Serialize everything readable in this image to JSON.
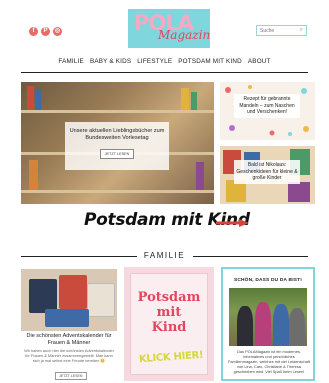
{
  "header": {
    "social": [
      "f",
      "P",
      "◎"
    ],
    "logo_main": "POLA",
    "logo_sub": "Magazin",
    "search_placeholder": "Suche"
  },
  "nav": {
    "items": [
      "FAMILIE",
      "BABY & KIDS",
      "LIFESTYLE",
      "POTSDAM MIT KIND",
      "ABOUT"
    ]
  },
  "hero": {
    "title": "Unsere aktuellen Lieblingsbücher zum Bundesweiten Vorlesetag",
    "button": "JETZT LESEN"
  },
  "side_posts": [
    {
      "title": "Rezept für gebrannte Mandeln – zum Naschen und Verschenken!"
    },
    {
      "title": "Bald ist Nikolaus: Geschenkideen für kleine & große Kinder"
    }
  ],
  "banner": {
    "text": "Potsdam mit Kind"
  },
  "section": {
    "title": "FAMILIE"
  },
  "card1": {
    "title": "Die schönsten Adventskalender für Frauen & Männer",
    "text": "Wir haben auch hier die schönsten Adventskalender für Frauen & Männer zusammengestellt. Man kann sich ja mal selbst eine Freude bereiten 🙂",
    "button": "JETZT LESEN"
  },
  "card2": {
    "line1": "Potsdam",
    "line2": "mit",
    "line3": "Kind",
    "cta": "KLICK HIER!"
  },
  "card3": {
    "heading": "SCHÖN, DASS DU DA BIST!",
    "text": "Das POLAMagazin ist ein modernes, informatives und persönliches Familienmagazin, welches mit viel Leidenschaft von Lina, Caro, Christiane & Theresa geschrieben wird. Viel Spaß beim Lesen!"
  },
  "colors": {
    "accent_teal": "#7fd6dc",
    "accent_pink": "#e2475f",
    "arrow_red": "#d4463c"
  }
}
